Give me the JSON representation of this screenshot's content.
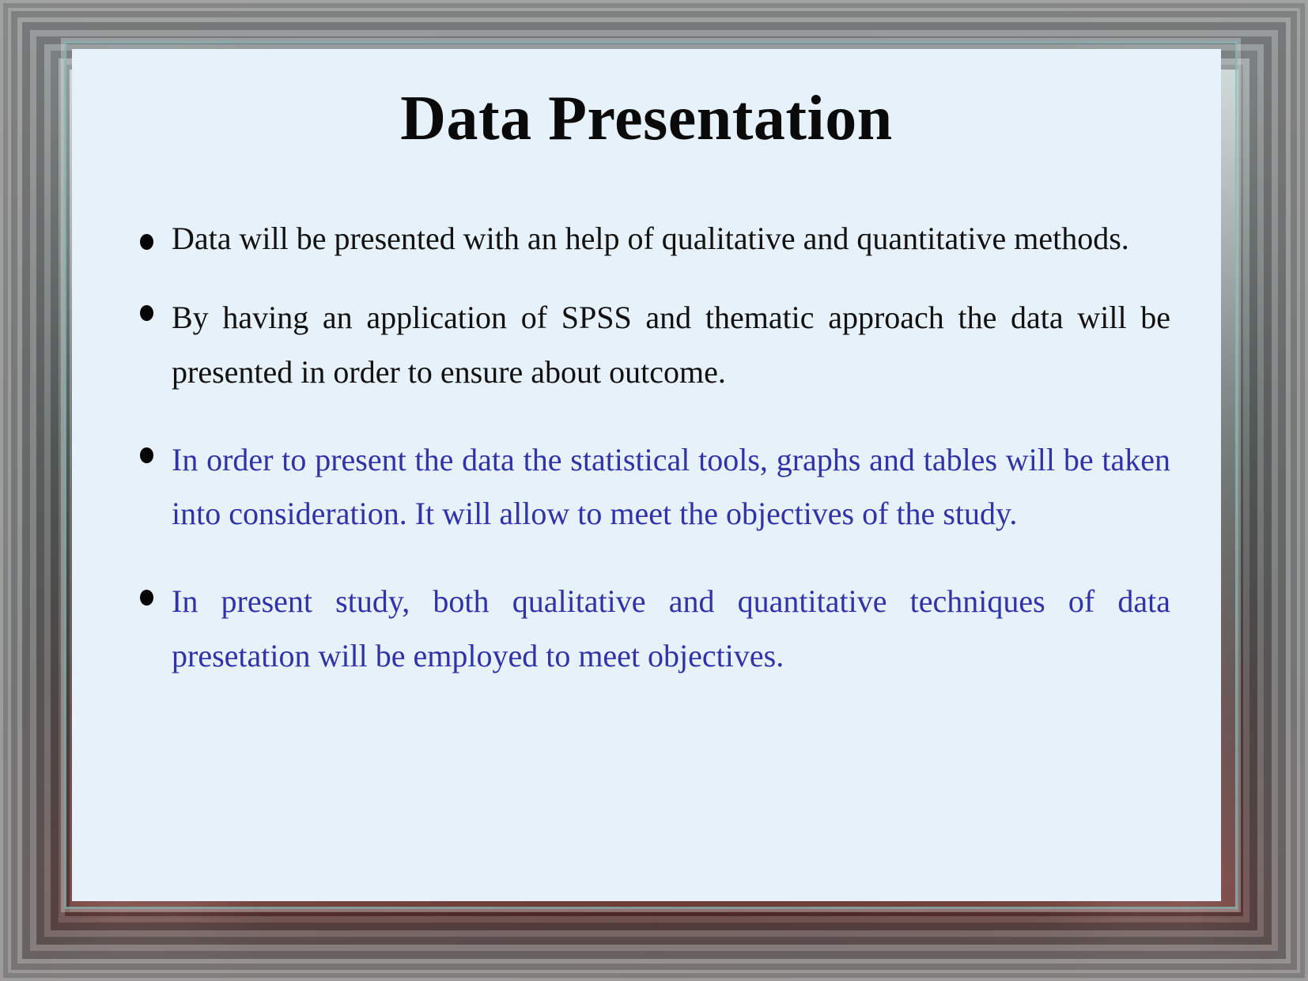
{
  "slide": {
    "title": "Data Presentation",
    "background_color": "#e6f1f9",
    "title_color": "#0a0a0a",
    "body_text_color": "#111111",
    "highlight_text_color": "#3232a8",
    "bullet_marker_color": "#050505",
    "bullets": [
      {
        "text": "Data will be presented with an help of qualitative and quantitative methods.",
        "color": "#111111",
        "emphasis": "normal"
      },
      {
        "text": "By having an application of SPSS and thematic approach the data will be presented in order to ensure about outcome.",
        "color": "#111111",
        "emphasis": "normal"
      },
      {
        "text": "In order to present the data the statistical tools, graphs and tables will be taken into consideration. It will allow to meet the objectives of the study.",
        "color": "#3232a8",
        "emphasis": "highlight"
      },
      {
        "text": "In present study, both qualitative and quantitative techniques of data presetation will be employed to meet objectives.",
        "color": "#3232a8",
        "emphasis": "highlight"
      }
    ]
  },
  "frame": {
    "style": "beveled-gradient-border",
    "top_tone": "#cfe0e2",
    "accent_teal": "#60b4af",
    "accent_pink": "#e1c8c8",
    "bottom_tone": "#0a0c0c",
    "bottom_accent_red": "#96282b"
  }
}
